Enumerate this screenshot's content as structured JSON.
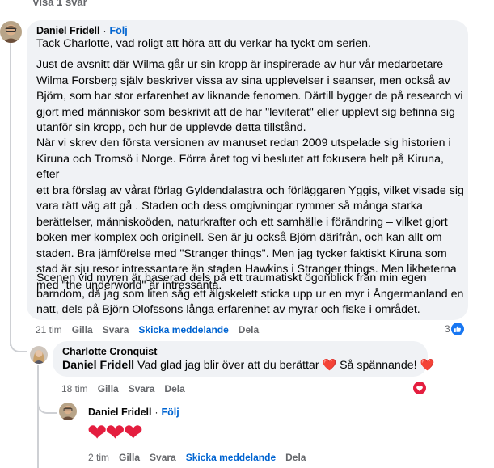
{
  "top_link": "Visa 1 svar",
  "comment1": {
    "author": "Daniel Fridell",
    "follow": "Följ",
    "paragraphs": [
      "Tack Charlotte, vad roligt att höra att du verkar ha tyckt om serien.",
      "Just de avsnitt där Wilma går ur sin kropp är inspirerade av hur vår medarbetare\nWilma Forsberg själv beskriver vissa av sina upplevelser i seanser, men också av\nBjörn, som har stor erfarenhet av liknande fenomen. Därtill bygger de på research vi\ngjort med människor som beskrivit att de har \"leviterat\" eller upplevt sig befinna sig\nutanför sin kropp, och hur de upplevde detta tillstånd.",
      "När vi skrev den första versionen av manuset redan 2009 utspelade sig historien i\nKiruna och Tromsö i Norge. Förra året tog vi beslutet att fokusera helt på Kiruna, efter\nett bra förslag av vårat förlag Gyldendalastra och förläggaren Yggis, vilket visade sig\nvara rätt väg att gå . Staden och dess omgivningar rymmer så många starka\nberättelser, människoöden, naturkrafter och ett samhälle i förändring – vilket gjort\nboken mer komplex och originell. Sen är ju också Björn därifrån, och kan allt om\nstaden. Bra jämförelse med \"Stranger things\". Men jag tycker faktiskt Kiruna som\nstad är sju resor intressantare än staden Hawkins i Stranger things. Men likheterna\nmed \"the underworld\" är intressanta.",
      "Scenen vid myren är baserad dels på ett traumatiskt ögonblick från min egen\nbarndom, då jag som liten såg ett älgskelett sticka upp ur en myr i Ångermanland en\nnatt, dels på Björn Olofssons långa erfarenhet av myrar och fiske i området."
    ],
    "time": "21 tim",
    "like": "Gilla",
    "reply": "Svara",
    "message": "Skicka meddelande",
    "share": "Dela",
    "reaction_count": "3"
  },
  "comment2": {
    "author": "Charlotte Cronquist",
    "mention": "Daniel Fridell",
    "text": " Vad glad jag blir över att du berättar ❤️ Så spännande! ❤️",
    "time": "18 tim",
    "like": "Gilla",
    "reply": "Svara",
    "share": "Dela"
  },
  "comment3": {
    "author": "Daniel Fridell",
    "follow": "Följ",
    "hearts": "❤❤❤",
    "time": "2 tim",
    "like": "Gilla",
    "reply": "Svara",
    "message": "Skicka meddelande",
    "share": "Dela"
  },
  "colors": {
    "bubble": "#f0f2f5",
    "link_blue": "#0064d1",
    "muted": "#65676b",
    "heart_red": "#e41e3f",
    "like_blue": "#1877f2",
    "thread_line": "#ced0d4"
  }
}
